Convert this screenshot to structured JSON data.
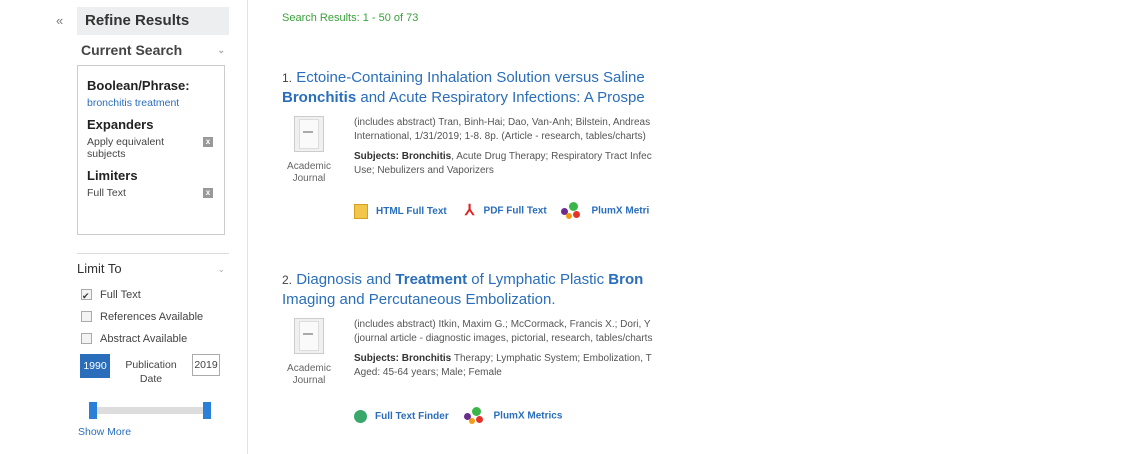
{
  "sidebar": {
    "collapse_icon": "«",
    "refine_title": "Refine Results",
    "current_search": {
      "header": "Current Search",
      "boolean_label": "Boolean/Phrase:",
      "query": "bronchitis treatment",
      "expanders_label": "Expanders",
      "expander_item": "Apply equivalent subjects",
      "limiters_label": "Limiters",
      "limiter_item": "Full Text",
      "remove_icon": "x"
    },
    "limit_to": {
      "header": "Limit To",
      "options": [
        {
          "label": "Full Text",
          "checked": true
        },
        {
          "label": "References Available",
          "checked": false
        },
        {
          "label": "Abstract Available",
          "checked": false
        }
      ],
      "date_from": "1990",
      "date_to": "2019",
      "date_label_1": "Publication",
      "date_label_2": "Date",
      "slider_from": 0.0,
      "slider_to": 1.0
    },
    "show_more": "Show More"
  },
  "results": {
    "count_text": "Search Results: 1 - 50 of 73",
    "items": [
      {
        "num": "1.",
        "title_parts": [
          {
            "text": "Ectoine-Containing Inhalation Solution versus Saline",
            "hl": false
          },
          {
            "text": "Bronchitis",
            "hl": true
          },
          {
            "text": " and Acute Respiratory Infections: A Prospe",
            "hl": false
          }
        ],
        "pub_type_1": "Academic",
        "pub_type_2": "Journal",
        "line1": "(includes abstract) Tran, Binh-Hai; Dao, Van-Anh; Bilstein, Andreas",
        "line2": "International, 1/31/2019; 1-8. 8p. (Article - research, tables/charts)",
        "subjects_label": "Subjects:",
        "subjects_hl": "Bronchitis",
        "subjects_rest": ", Acute Drug Therapy; Respiratory Tract Infec",
        "subjects_line2": "Use; Nebulizers and Vaporizers",
        "links": {
          "html": "HTML Full Text",
          "pdf": "PDF Full Text",
          "plumx": "PlumX Metri"
        }
      },
      {
        "num": "2.",
        "title_parts": [
          {
            "text": "Diagnosis and ",
            "hl": false
          },
          {
            "text": "Treatment",
            "hl": true
          },
          {
            "text": " of Lymphatic Plastic ",
            "hl": false
          },
          {
            "text": "Bron",
            "hl": true
          },
          {
            "text": "Imaging and Percutaneous Embolization.",
            "hl": false
          }
        ],
        "pub_type_1": "Academic",
        "pub_type_2": "Journal",
        "line1": "(includes abstract) Itkin, Maxim G.; McCormack, Francis X.; Dori, Y",
        "line2": "(journal article - diagnostic images, pictorial, research, tables/charts",
        "subjects_label": "Subjects:",
        "subjects_hl": "Bronchitis",
        "subjects_rest": " Therapy; Lymphatic System; Embolization, T",
        "subjects_line2": "Aged: 45-64 years; Male; Female",
        "links": {
          "ftf": "Full Text Finder",
          "plumx": "PlumX Metrics"
        }
      }
    ]
  },
  "colors": {
    "link": "#2a6ebb",
    "count": "#3aa03a",
    "slider": "#2a80d8"
  }
}
